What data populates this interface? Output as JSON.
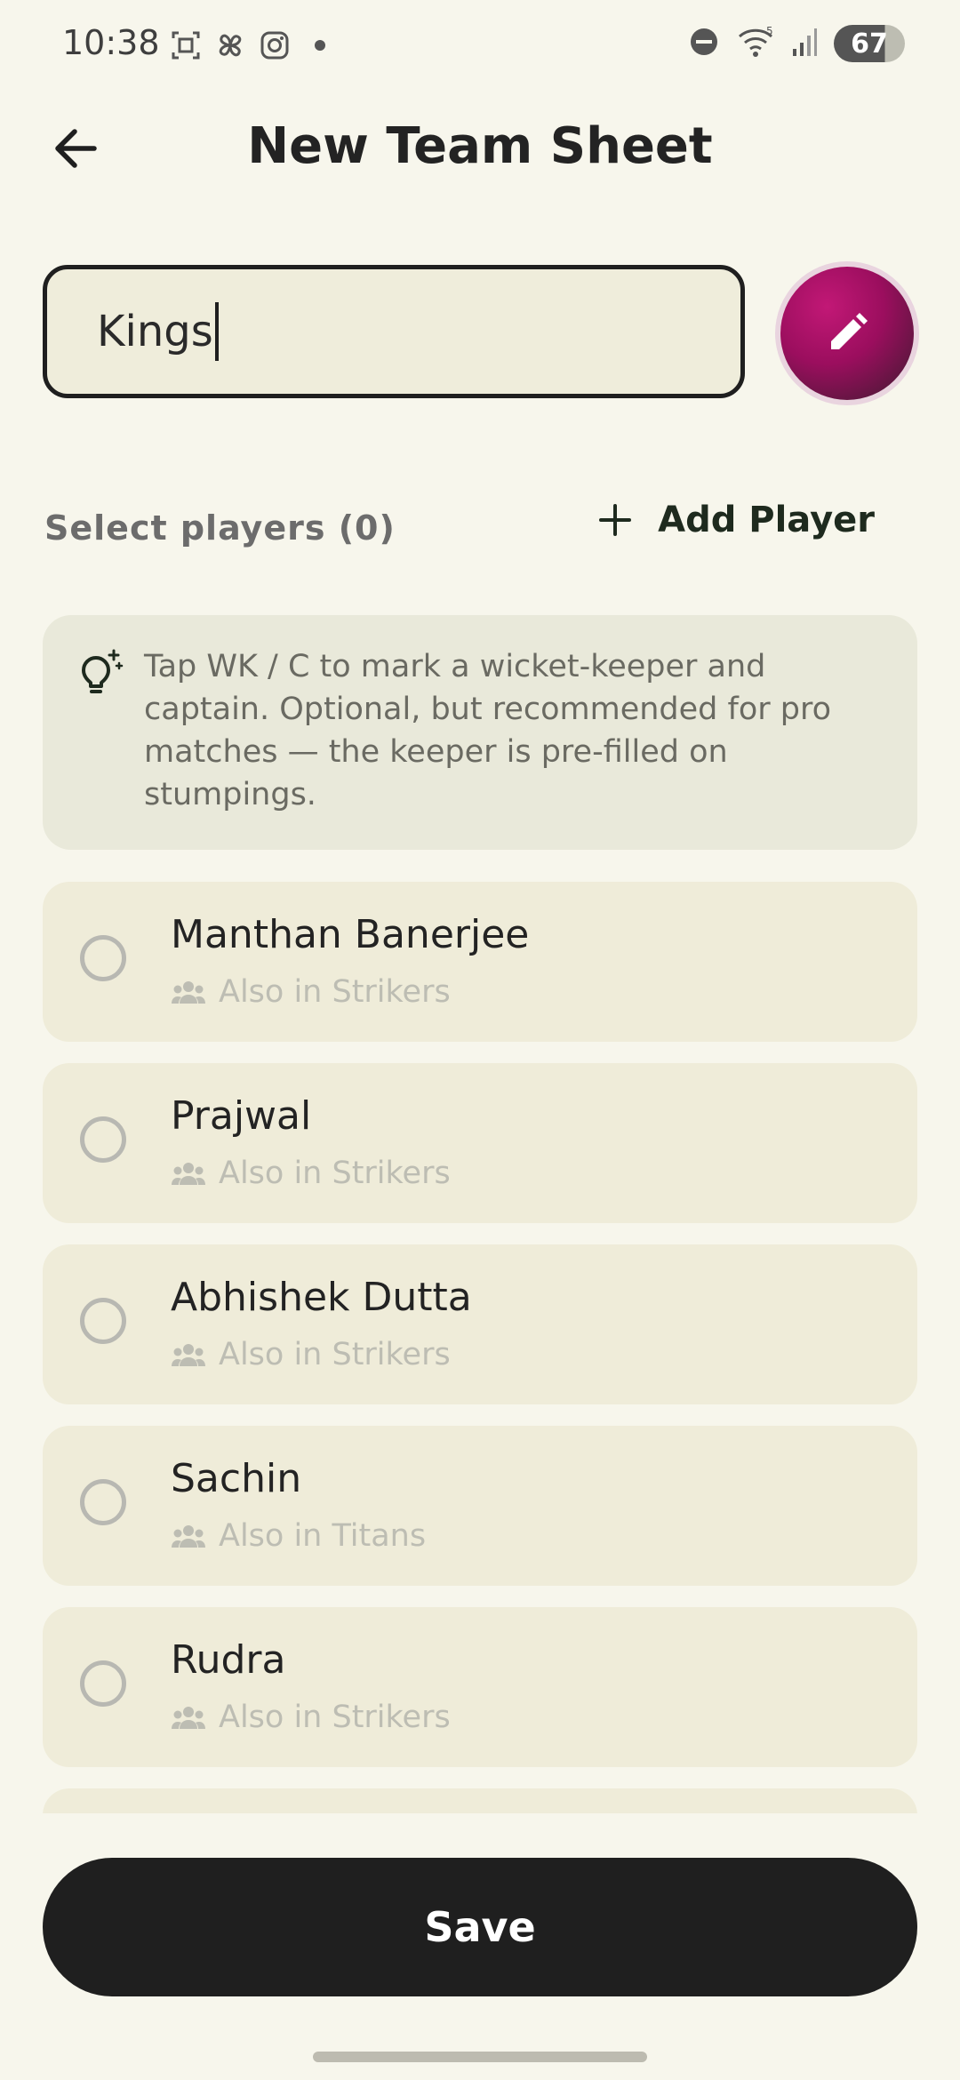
{
  "status_bar": {
    "time": "10:38",
    "battery": "67",
    "icons": [
      "screenshot-icon",
      "pinwheel-icon",
      "instagram-icon",
      "notification-dot",
      "dnd-icon",
      "wifi-icon",
      "signal-icon",
      "battery-icon"
    ]
  },
  "header": {
    "title": "New Team Sheet",
    "back_icon": "arrow-left-icon"
  },
  "team_name_input": {
    "value": "Kings"
  },
  "edit_button": {
    "icon": "pencil-icon",
    "color": "#B0146C"
  },
  "players_section": {
    "label": "Select players (0)",
    "add_label": "Add Player"
  },
  "tip": {
    "icon": "lightbulb-sparkle-icon",
    "text": "Tap WK / C to mark a wicket-keeper and captain. Optional, but recommended for pro matches — the keeper is pre-filled on stumpings."
  },
  "players": [
    {
      "name": "Manthan Banerjee",
      "sub": "Also in Strikers"
    },
    {
      "name": "Prajwal",
      "sub": "Also in Strikers"
    },
    {
      "name": "Abhishek Dutta",
      "sub": "Also in Strikers"
    },
    {
      "name": "Sachin",
      "sub": "Also in Titans"
    },
    {
      "name": "Rudra",
      "sub": "Also in Strikers"
    }
  ],
  "save": {
    "label": "Save"
  },
  "colors": {
    "background": "#F7F6EC",
    "card": "#EFECD9",
    "tip_bg": "#E9E9DA",
    "primary_dark": "#1F1F1F",
    "accent": "#B0146C"
  }
}
